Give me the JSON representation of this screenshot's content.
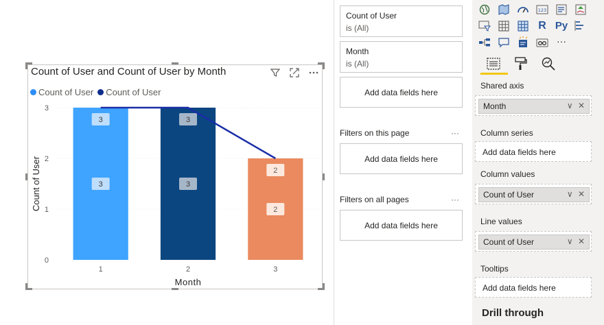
{
  "visual": {
    "title": "Count of User and Count of User by Month",
    "legend": [
      {
        "label": "Count of User",
        "color": "#2e8ef7"
      },
      {
        "label": "Count of User",
        "color": "#0e2e8c"
      }
    ]
  },
  "chart_data": {
    "type": "bar",
    "categories": [
      "1",
      "2",
      "3"
    ],
    "series": [
      {
        "name": "Count of User",
        "kind": "column",
        "values": [
          3,
          3,
          2
        ],
        "colors": [
          "#3ea4ff",
          "#0b4680",
          "#ea8a5e"
        ],
        "data_labels": [
          "3",
          "3",
          "2"
        ]
      },
      {
        "name": "Count of User",
        "kind": "line",
        "values": [
          3,
          3,
          2
        ],
        "color": "#1a2ea8",
        "data_labels": [
          "3",
          "3",
          "2"
        ]
      }
    ],
    "xlabel": "Month",
    "ylabel": "Count of User",
    "ylim": [
      0,
      3
    ],
    "yticks": [
      "0",
      "1",
      "2",
      "3"
    ],
    "grid": true,
    "legend": "top-left"
  },
  "filters": {
    "visual_filters": [
      {
        "name": "Count of User",
        "value": "is (All)"
      },
      {
        "name": "Month",
        "value": "is (All)"
      }
    ],
    "add_fields": "Add data fields here",
    "page_heading": "Filters on this page",
    "all_heading": "Filters on all pages",
    "more": "···"
  },
  "viz_pane": {
    "icons": [
      "globe-map-icon",
      "filled-map-icon",
      "gauge-icon",
      "card-icon",
      "multirow-card-icon",
      "kpi-icon",
      "slicer-icon",
      "table-icon",
      "matrix-icon",
      "r-visual-icon",
      "python-visual-icon",
      "key-influencers-icon",
      "decomposition-tree-icon",
      "qa-icon",
      "smart-narrative-icon",
      "paginated-icon"
    ],
    "r_label": "R",
    "py_label": "Py",
    "more": "···",
    "wells": {
      "shared_axis": {
        "label": "Shared axis",
        "field": "Month"
      },
      "column_series": {
        "label": "Column series",
        "empty": "Add data fields here"
      },
      "column_values": {
        "label": "Column values",
        "field": "Count of User"
      },
      "line_values": {
        "label": "Line values",
        "field": "Count of User"
      },
      "tooltips": {
        "label": "Tooltips",
        "empty": "Add data fields here"
      }
    },
    "field_controls": "∨ ✕",
    "drill_through": "Drill through"
  }
}
